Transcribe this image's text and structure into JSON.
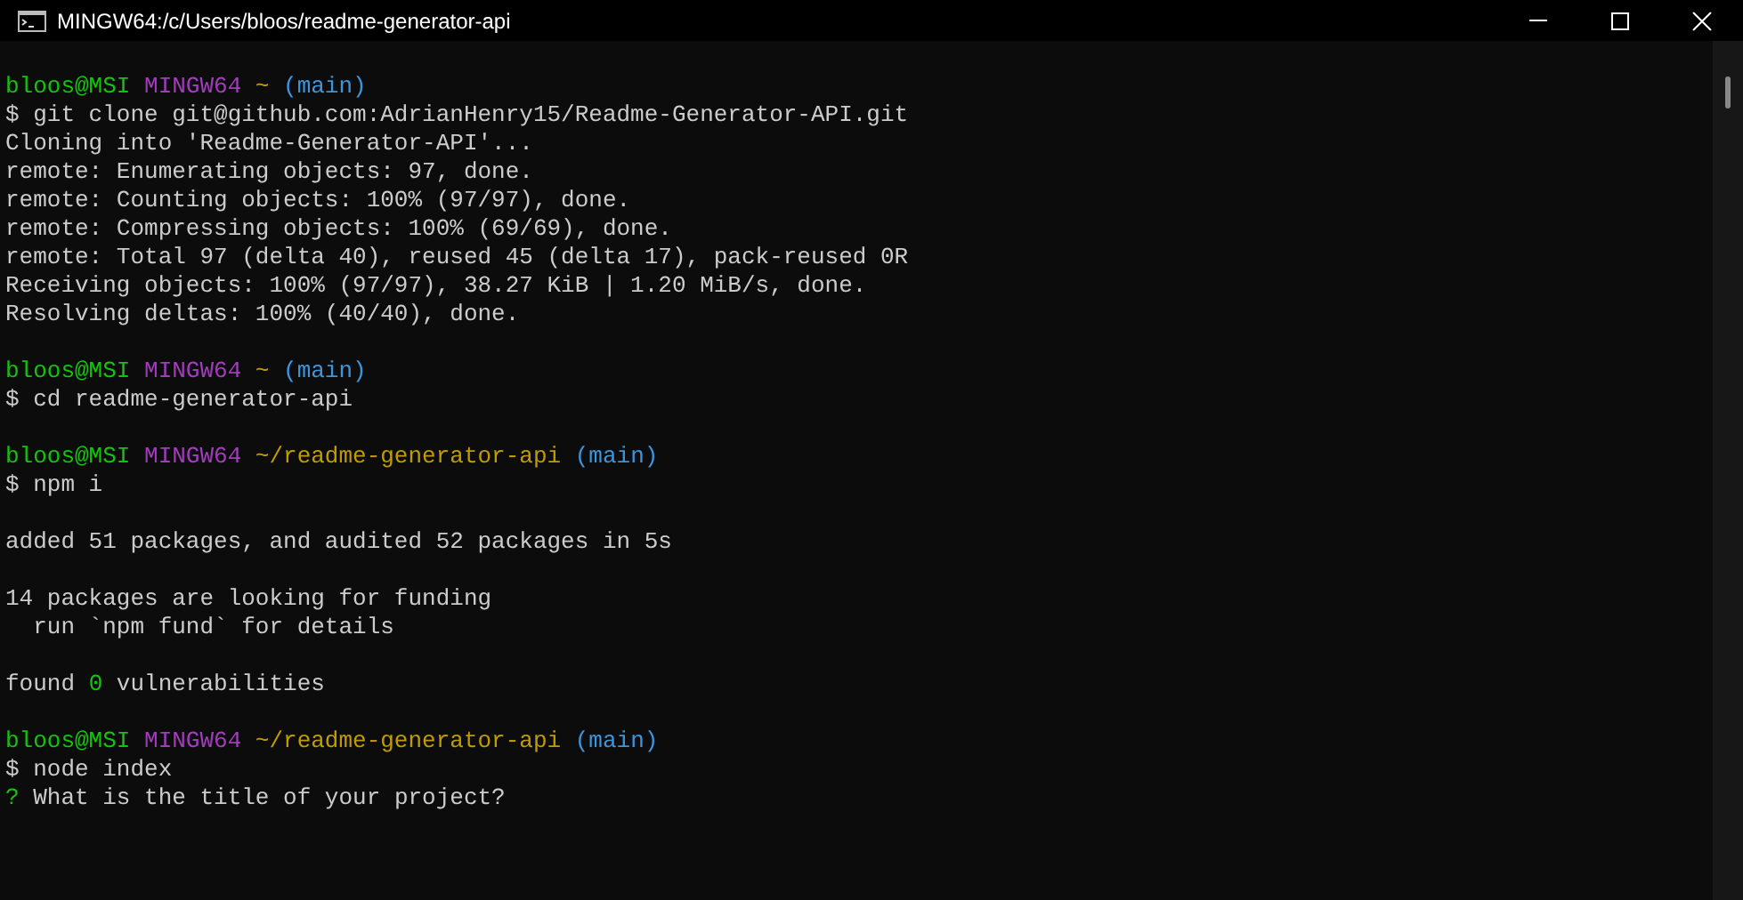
{
  "window": {
    "title": "MINGW64:/c/Users/bloos/readme-generator-api"
  },
  "terminal": {
    "blocks": [
      {
        "lines": [
          [
            {
              "kind": "user",
              "text": "bloos@MSI"
            },
            {
              "kind": "host",
              "text": "MINGW64"
            },
            {
              "kind": "path",
              "text": "~"
            },
            {
              "kind": "branch",
              "text": "(main)"
            }
          ],
          [
            {
              "kind": "plain",
              "text": "$ git clone git@github.com:AdrianHenry15/Readme-Generator-API.git"
            }
          ],
          [
            {
              "kind": "plain",
              "text": "Cloning into 'Readme-Generator-API'..."
            }
          ],
          [
            {
              "kind": "plain",
              "text": "remote: Enumerating objects: 97, done."
            }
          ],
          [
            {
              "kind": "plain",
              "text": "remote: Counting objects: 100% (97/97), done."
            }
          ],
          [
            {
              "kind": "plain",
              "text": "remote: Compressing objects: 100% (69/69), done."
            }
          ],
          [
            {
              "kind": "plain",
              "text": "remote: Total 97 (delta 40), reused 45 (delta 17), pack-reused 0R"
            }
          ],
          [
            {
              "kind": "plain",
              "text": "Receiving objects: 100% (97/97), 38.27 KiB | 1.20 MiB/s, done."
            }
          ],
          [
            {
              "kind": "plain",
              "text": "Resolving deltas: 100% (40/40), done."
            }
          ]
        ]
      },
      {
        "lines": [
          [
            {
              "kind": "user",
              "text": "bloos@MSI"
            },
            {
              "kind": "host",
              "text": "MINGW64"
            },
            {
              "kind": "path",
              "text": "~"
            },
            {
              "kind": "branch",
              "text": "(main)"
            }
          ],
          [
            {
              "kind": "plain",
              "text": "$ cd readme-generator-api"
            }
          ]
        ]
      },
      {
        "lines": [
          [
            {
              "kind": "user",
              "text": "bloos@MSI"
            },
            {
              "kind": "host",
              "text": "MINGW64"
            },
            {
              "kind": "path",
              "text": "~/readme-generator-api"
            },
            {
              "kind": "branch",
              "text": "(main)"
            }
          ],
          [
            {
              "kind": "plain",
              "text": "$ npm i"
            }
          ]
        ]
      },
      {
        "lines": [
          [
            {
              "kind": "plain",
              "text": "added 51 packages, and audited 52 packages in 5s"
            }
          ]
        ]
      },
      {
        "lines": [
          [
            {
              "kind": "plain",
              "text": "14 packages are looking for funding"
            }
          ],
          [
            {
              "kind": "plain",
              "text": "  run `npm fund` for details"
            }
          ]
        ]
      },
      {
        "lines": [
          [
            {
              "kind": "plain",
              "text": "found"
            },
            {
              "kind": "number",
              "text": "0"
            },
            {
              "kind": "plain",
              "text": "vulnerabilities"
            }
          ]
        ]
      },
      {
        "lines": [
          [
            {
              "kind": "user",
              "text": "bloos@MSI"
            },
            {
              "kind": "host",
              "text": "MINGW64"
            },
            {
              "kind": "path",
              "text": "~/readme-generator-api"
            },
            {
              "kind": "branch",
              "text": "(main)"
            }
          ],
          [
            {
              "kind": "plain",
              "text": "$ node index"
            }
          ],
          [
            {
              "kind": "mark",
              "text": "?"
            },
            {
              "kind": "plain",
              "text": "What is the title of your project?"
            }
          ]
        ]
      }
    ]
  }
}
